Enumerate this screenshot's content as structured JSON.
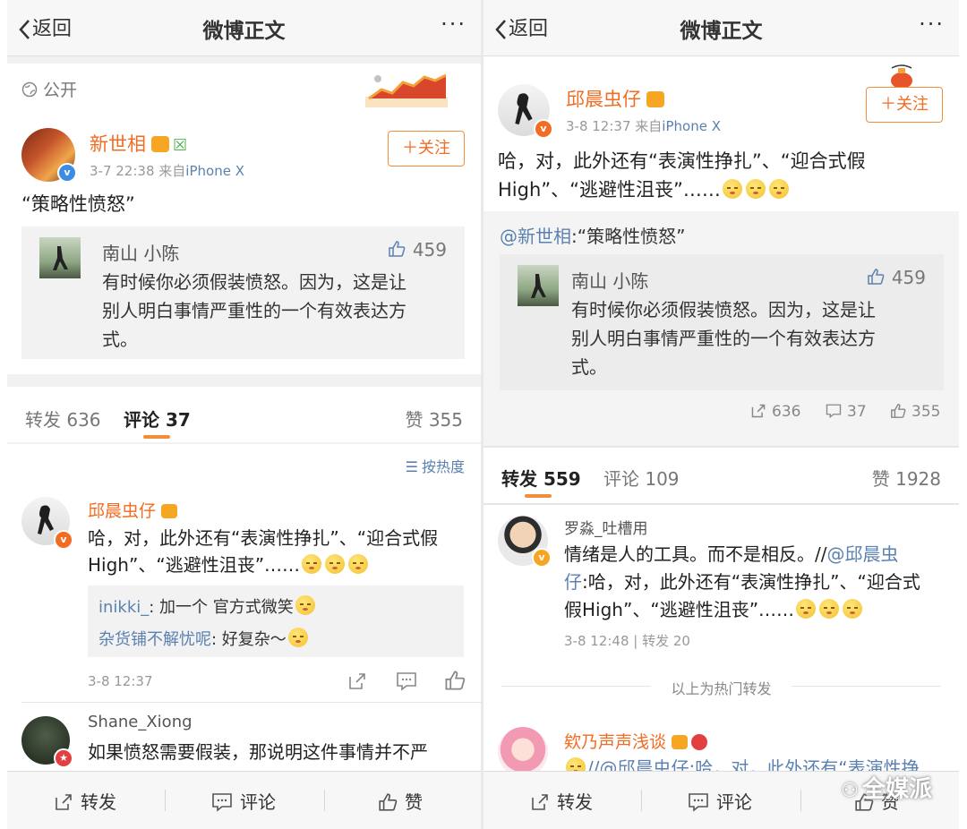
{
  "left": {
    "nav": {
      "back": "返回",
      "title": "微博正文",
      "more": "···"
    },
    "visibility": "公开",
    "post": {
      "author": "新世相",
      "time": "3-7 22:38",
      "source_prefix": "来自",
      "source": "iPhone X",
      "follow": "＋关注",
      "text": "“策略性愤怒”",
      "quoted": {
        "name": "南山 小陈",
        "likes": "459",
        "text": "有时候你必须假装愤怒。因为，这是让别人明白事情严重性的一个有效表达方式。",
        "line1": "有时候你必须假装愤怒。因为，这是让",
        "line2": "别人明白事情严重性的一个有效表达方",
        "line3": "式。"
      }
    },
    "tabs": {
      "repost": "转发 636",
      "comment": "评论 37",
      "like": "赞 355"
    },
    "sort": "按热度",
    "comments": [
      {
        "name": "邱晨虫仔",
        "line1": "哈，对，此外还有“表演性挣扎”、“迎合式假",
        "line2": "High”、“逃避性沮丧”……",
        "replies": [
          {
            "name": "inikki_",
            "text": ": 加一个 官方式微笑"
          },
          {
            "name": "杂货铺不解忧呢",
            "text": ": 好复杂～"
          }
        ],
        "time": "3-8 12:37"
      },
      {
        "name": "Shane_Xiong",
        "text": "如果愤怒需要假装，那说明这件事情并不严"
      }
    ],
    "bottom": {
      "repost": "转发",
      "comment": "评论",
      "like": "赞"
    }
  },
  "right": {
    "nav": {
      "back": "返回",
      "title": "微博正文",
      "more": "···"
    },
    "post": {
      "author": "邱晨虫仔",
      "time": "3-8 12:37",
      "source_prefix": "来自",
      "source": "iPhone X",
      "follow": "＋关注",
      "line1": "哈，对，此外还有“表演性挣扎”、“迎合式假",
      "line2": "High”、“逃避性沮丧”……",
      "retweet": {
        "mention": "@新世相",
        "text": ":“策略性愤怒”",
        "quoted": {
          "name": "南山 小陈",
          "likes": "459",
          "line1": "有时候你必须假装愤怒。因为，这是让",
          "line2": "别人明白事情严重性的一个有效表达方",
          "line3": "式。"
        },
        "stats": {
          "repost": "636",
          "comment": "37",
          "like": "355"
        }
      }
    },
    "tabs": {
      "repost": "转发 559",
      "comment": "评论 109",
      "like": "赞 1928"
    },
    "reposts": [
      {
        "name": "罗淼_吐槽用",
        "line1_a": "情绪是人的工具。而不是相反。//",
        "line1_b": "@邱晨虫",
        "line2_a": "仔",
        "line2_b": ":哈，对，此外还有“表演性挣扎”、“迎合式",
        "line3": "假High”、“逃避性沮丧”……",
        "time": "3-8 12:48",
        "repost_count": "转发 20"
      }
    ],
    "hot_divider": "以上为热门转发",
    "next_repost": {
      "name": "欸乃声声浅谈",
      "text": "//@邱晨虫仔:哈，对，此外还有“表演性挣"
    },
    "bottom": {
      "repost": "转发",
      "comment": "评论",
      "like": "赞"
    },
    "watermark": "全媒派"
  }
}
